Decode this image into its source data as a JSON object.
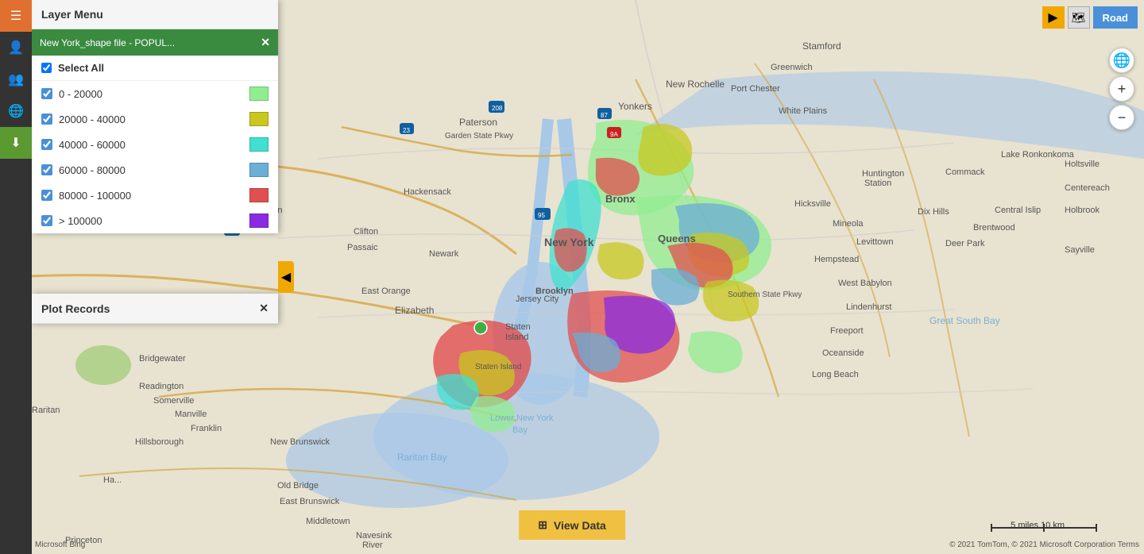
{
  "sidebar": {
    "icons": [
      {
        "name": "layers-icon",
        "symbol": "☰",
        "active": false,
        "style": "orange"
      },
      {
        "name": "person-icon",
        "symbol": "👤",
        "active": false,
        "style": "dark"
      },
      {
        "name": "user-group-icon",
        "symbol": "👥",
        "active": false,
        "style": "dark"
      },
      {
        "name": "globe-icon",
        "symbol": "🌐",
        "active": false,
        "style": "dark"
      },
      {
        "name": "download-icon",
        "symbol": "⬇",
        "active": true,
        "style": "green"
      }
    ]
  },
  "layer_menu": {
    "title": "Layer Menu",
    "layer_item": {
      "title": "New York_shape file - POPUL...",
      "close_label": "✕"
    },
    "select_all": {
      "label": "Select All",
      "checked": true
    },
    "legend_items": [
      {
        "label": "0 - 20000",
        "color": "#90ee90",
        "checked": true
      },
      {
        "label": "20000 - 40000",
        "color": "#c8c820",
        "checked": true
      },
      {
        "label": "40000 - 60000",
        "color": "#40e0d0",
        "checked": true
      },
      {
        "label": "60000 - 80000",
        "color": "#6baed6",
        "checked": true
      },
      {
        "label": "80000 - 100000",
        "color": "#e05050",
        "checked": true
      },
      {
        "label": "> 100000",
        "color": "#8a2be2",
        "checked": true
      }
    ]
  },
  "plot_records": {
    "title": "Plot Records",
    "close_label": "✕"
  },
  "collapse_btn": {
    "symbol": "◀"
  },
  "top_right": {
    "expand_symbol": "▶",
    "road_label": "Road"
  },
  "zoom_controls": {
    "plus": "+",
    "minus": "−",
    "globe": "🌐"
  },
  "view_data_btn": {
    "icon": "⊞",
    "label": "View Data"
  },
  "scale": {
    "label": "5 miles       10 km"
  },
  "copyright": {
    "text": "© 2021 TomTom, © 2021 Microsoft Corporation  Terms"
  },
  "ms_bing": {
    "text": "Microsoft Bing"
  }
}
